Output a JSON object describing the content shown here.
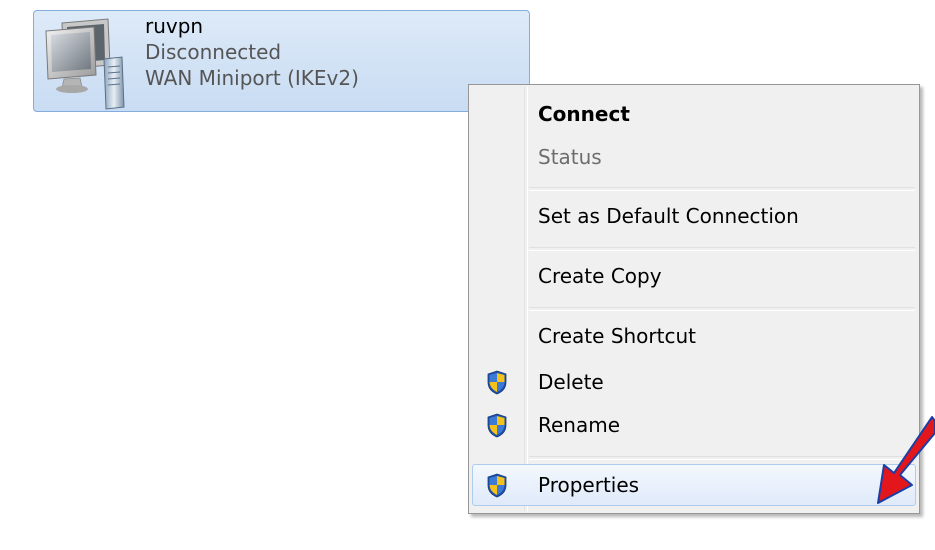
{
  "connection": {
    "name": "ruvpn",
    "status": "Disconnected",
    "device": "WAN Miniport (IKEv2)",
    "icon": "network-computer-icon"
  },
  "context_menu": {
    "items": [
      {
        "label": "Connect",
        "bold": true,
        "enabled": true
      },
      {
        "label": "Status",
        "enabled": false
      },
      {
        "label": "Set as Default Connection",
        "enabled": true
      },
      {
        "label": "Create Copy",
        "enabled": true
      },
      {
        "label": "Create Shortcut",
        "enabled": true
      },
      {
        "label": "Delete",
        "enabled": true,
        "icon": "uac-shield-icon"
      },
      {
        "label": "Rename",
        "enabled": true,
        "icon": "uac-shield-icon"
      },
      {
        "label": "Properties",
        "enabled": true,
        "icon": "uac-shield-icon",
        "highlighted": true
      }
    ]
  },
  "annotation": {
    "arrow_color": "#e3171b",
    "arrow_outline": "#1a3ea8",
    "points_to": "Properties"
  },
  "colors": {
    "selection_fill": "#cfe0f5",
    "selection_border": "#84acdd",
    "menu_background": "#f0f0f0",
    "menu_highlight": "#e6eefa"
  }
}
